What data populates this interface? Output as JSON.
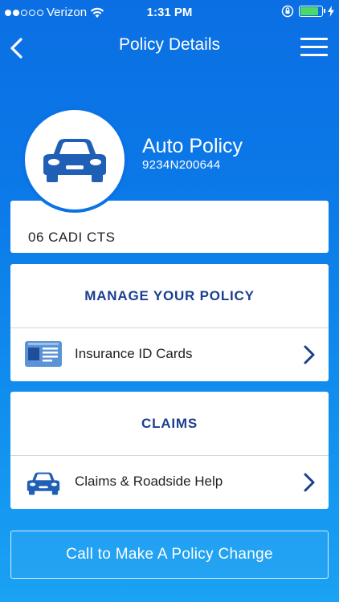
{
  "status_bar": {
    "carrier": "Verizon",
    "time": "1:31 PM",
    "signal_bars_filled": 2,
    "signal_bars_total": 5,
    "icons": [
      "wifi-icon",
      "rotation-lock-icon",
      "battery-icon",
      "charging-icon"
    ],
    "battery_level": 0.85
  },
  "nav": {
    "title": "Policy Details",
    "back_icon": "chevron-left-icon",
    "menu_icon": "hamburger-menu-icon"
  },
  "policy": {
    "type": "Auto Policy",
    "number": "9234N200644",
    "icon": "car-icon",
    "vehicle": "06 CADI CTS"
  },
  "manage_section": {
    "header": "MANAGE YOUR POLICY",
    "row_label": "Insurance ID Cards",
    "row_icon": "id-card-icon"
  },
  "claims_section": {
    "header": "CLAIMS",
    "row_label": "Claims & Roadside Help",
    "row_icon": "car-icon"
  },
  "call_button": {
    "label": "Call to Make A Policy Change"
  },
  "colors": {
    "background_top": "#0b6fe3",
    "background_bottom": "#1aa2f3",
    "header_text": "#1a3f8f",
    "icon_blue": "#1f5fb5",
    "battery": "#4cd964"
  }
}
